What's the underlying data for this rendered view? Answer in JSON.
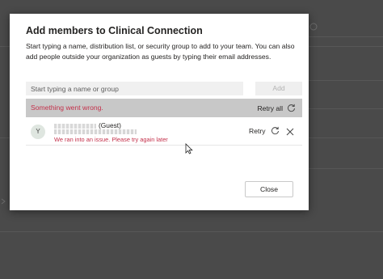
{
  "dialog": {
    "title": "Add members to Clinical Connection",
    "description": "Start typing a name, distribution list, or security group to add to your team. You can also add people outside your organization as guests by typing their email addresses.",
    "search": {
      "placeholder": "Start typing a name or group",
      "value": ""
    },
    "add_label": "Add",
    "error_banner": {
      "message": "Something went wrong.",
      "retry_all_label": "Retry all",
      "message_color": "#c4314b"
    },
    "members": [
      {
        "avatar_initial": "Y",
        "guest_suffix": "(Guest)",
        "error": "We ran into an issue. Please try again later",
        "retry_label": "Retry",
        "icons": [
          "refresh-icon",
          "close-icon"
        ]
      }
    ],
    "close_label": "Close"
  },
  "colors": {
    "overlay": "#4a4a4a",
    "error_text": "#c4314b",
    "error_bar_bg": "#c8c8c8",
    "dialog_bg": "#ffffff"
  }
}
